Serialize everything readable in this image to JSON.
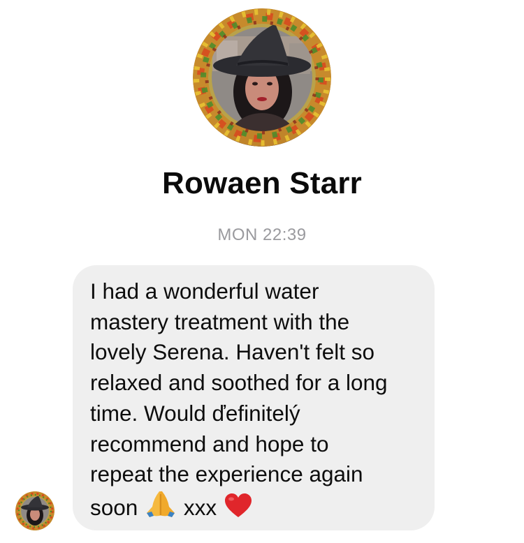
{
  "contact": {
    "name": "Rowaen Starr"
  },
  "thread": {
    "timestamp": "MON 22:39"
  },
  "message": {
    "text": "I had a wonderful water\nmastery treatment with the\nlovely Serena. Haven't felt so\nrelaxed and soothed for a long\ntime. Would ďefinitelý\nrecommend and hope to\nrepeat the experience again\nsoon",
    "suffix": "xxx",
    "emojis": [
      "folded-hands",
      "red-heart"
    ]
  },
  "colors": {
    "bubble": "#efefef",
    "timestamp": "#9a9a9e",
    "heart": "#e0262b"
  }
}
